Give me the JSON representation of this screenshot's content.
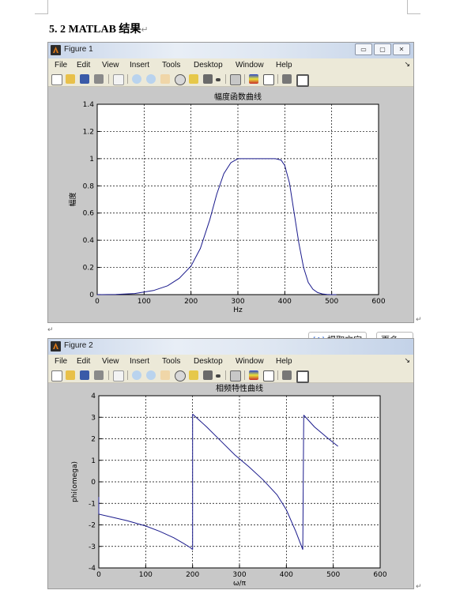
{
  "doc": {
    "heading": "5. 2 MATLAB 结果",
    "heading_mark": "↵",
    "para_mark": "↵"
  },
  "figures": [
    {
      "window_title": "Figure 1",
      "window_buttons": [
        "▭",
        "▢",
        "✕"
      ],
      "menu": [
        "File",
        "Edit",
        "View",
        "Insert",
        "Tools",
        "Desktop",
        "Window",
        "Help"
      ],
      "menu_overflow": "↘",
      "toolbar_icons": [
        "new-file-icon",
        "open-folder-icon",
        "save-icon",
        "print-icon",
        "pointer-icon",
        "zoom-in-icon",
        "zoom-out-icon",
        "pan-hand-icon",
        "rotate-3d-icon",
        "data-cursor-icon",
        "brush-icon",
        "brush-dropdown-icon",
        "link-plot-icon",
        "insert-colorbar-icon",
        "insert-legend-icon",
        "hide-plot-tools-icon",
        "show-plot-tools-icon"
      ]
    },
    {
      "window_title": "Figure 2",
      "menu": [
        "File",
        "Edit",
        "View",
        "Insert",
        "Tools",
        "Desktop",
        "Window",
        "Help"
      ],
      "menu_overflow": "↘",
      "toolbar_icons": [
        "new-file-icon",
        "open-folder-icon",
        "save-icon",
        "print-icon",
        "pointer-icon",
        "zoom-in-icon",
        "zoom-out-icon",
        "pan-hand-icon",
        "rotate-3d-icon",
        "data-cursor-icon",
        "brush-icon",
        "brush-dropdown-icon",
        "link-plot-icon",
        "insert-colorbar-icon",
        "insert-legend-icon",
        "hide-plot-tools-icon",
        "show-plot-tools-icon"
      ]
    }
  ],
  "overlay": {
    "extract_text_label": "提取文字",
    "extract_text_icon": "[A]",
    "more_label": "更多 ⌄"
  },
  "chart_data": [
    {
      "type": "line",
      "title": "幅度函数曲线",
      "xlabel": "Hz",
      "ylabel": "幅度",
      "xlim": [
        0,
        600
      ],
      "ylim": [
        0,
        1.4
      ],
      "xticks": [
        0,
        100,
        200,
        300,
        400,
        500,
        600
      ],
      "yticks": [
        0,
        0.2,
        0.4,
        0.6,
        0.8,
        1,
        1.2,
        1.4
      ],
      "grid": true,
      "line_color": "#1a1a8c",
      "series": [
        {
          "x": [
            0,
            40,
            80,
            120,
            150,
            175,
            200,
            220,
            240,
            255,
            270,
            285,
            300,
            320,
            340,
            360,
            380,
            392,
            400,
            410,
            420,
            430,
            440,
            450,
            460,
            470,
            480,
            490,
            500,
            510
          ],
          "values": [
            0,
            0.002,
            0.008,
            0.03,
            0.065,
            0.12,
            0.21,
            0.34,
            0.55,
            0.74,
            0.89,
            0.97,
            1.0,
            1.0,
            1.0,
            1.0,
            1.0,
            0.99,
            0.95,
            0.82,
            0.6,
            0.38,
            0.2,
            0.09,
            0.04,
            0.015,
            0.005,
            0.002,
            0.0,
            0.0
          ]
        }
      ]
    },
    {
      "type": "line",
      "title": "相频特性曲线",
      "xlabel": "ω/π",
      "ylabel": "phi(omega)",
      "xlim": [
        0,
        600
      ],
      "ylim": [
        -4,
        4
      ],
      "xticks": [
        0,
        100,
        200,
        300,
        400,
        500,
        600
      ],
      "yticks": [
        -4,
        -3,
        -2,
        -1,
        0,
        1,
        2,
        3,
        4
      ],
      "grid": true,
      "line_color": "#1a1a8c",
      "series": [
        {
          "segments": [
            {
              "x": [
                0,
                0,
                0,
                0
              ],
              "values": [
                -0.7,
                -0.9,
                -1.3,
                -1.5
              ]
            },
            {
              "x": [
                0,
                30,
                60,
                100,
                130,
                160,
                180,
                195,
                200
              ],
              "values": [
                -1.5,
                -1.65,
                -1.8,
                -2.05,
                -2.3,
                -2.6,
                -2.85,
                -3.05,
                -3.15
              ]
            },
            {
              "x": [
                200,
                200
              ],
              "values": [
                -3.15,
                3.15
              ]
            },
            {
              "x": [
                200,
                230,
                260,
                290,
                320,
                350,
                380,
                400,
                420,
                435
              ],
              "values": [
                3.15,
                2.55,
                1.9,
                1.25,
                0.7,
                0.1,
                -0.6,
                -1.3,
                -2.3,
                -3.15
              ]
            },
            {
              "x": [
                435,
                437
              ],
              "values": [
                -3.15,
                3.1
              ]
            },
            {
              "x": [
                437,
                460,
                490,
                510
              ],
              "values": [
                3.1,
                2.55,
                2.0,
                1.65
              ]
            }
          ]
        }
      ]
    }
  ]
}
